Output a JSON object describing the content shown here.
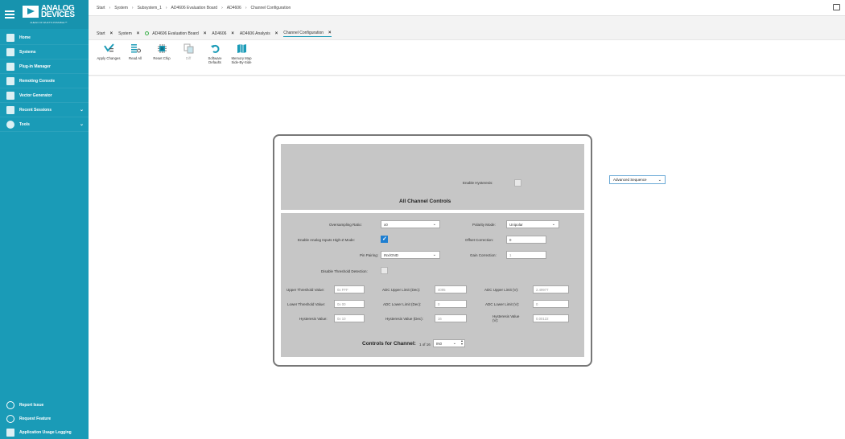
{
  "sidebar": {
    "logo_line1": "ANALOG",
    "logo_line2": "DEVICES",
    "logo_tagline": "AHEAD OF WHAT'S POSSIBLE™",
    "items": [
      {
        "label": "Home",
        "icon": "home-icon"
      },
      {
        "label": "Systems",
        "icon": "systems-icon"
      },
      {
        "label": "Plug-in Manager",
        "icon": "plugin-icon"
      },
      {
        "label": "Remoting Console",
        "icon": "console-icon"
      },
      {
        "label": "Vector Generator",
        "icon": "vector-icon"
      },
      {
        "label": "Recent Sessions",
        "icon": "recent-icon",
        "expandable": true
      },
      {
        "label": "Tools",
        "icon": "tools-icon",
        "expandable": true
      }
    ],
    "bottom_items": [
      {
        "label": "Report Issue",
        "icon": "info-icon"
      },
      {
        "label": "Request Feature",
        "icon": "lightbulb-icon"
      },
      {
        "label": "Application Usage Logging",
        "icon": "log-icon"
      }
    ]
  },
  "breadcrumb": [
    "Start",
    "System",
    "Subsystem_1",
    "AD4606 Evaluation Board",
    "AD4606",
    "Channel Configuration"
  ],
  "tabs": [
    {
      "label": "Start"
    },
    {
      "label": "System"
    },
    {
      "label": "AD4606 Evaluation Board",
      "status": true
    },
    {
      "label": "AD4606"
    },
    {
      "label": "AD4606 Analysis"
    },
    {
      "label": "Channel Configuration",
      "active": true
    }
  ],
  "toolbar": {
    "apply_changes": "Apply Changes",
    "read_all": "Read All",
    "reset_chip": "Reset Chip",
    "diff": "Diff",
    "software_defaults": "Software Defaults",
    "memory_map": "Memory Map Side-By-Side"
  },
  "panel": {
    "enable_hysteresis_label": "Enable Hysteresis:",
    "enable_hysteresis": false,
    "all_channel_title": "All Channel Controls",
    "oversampling_label": "Oversampling Ratio:",
    "oversampling_value": "x0",
    "polarity_label": "Polarity Mode:",
    "polarity_value": "Unipolar",
    "analog_hiz_label": "Enable Analog Inputs High-Z Mode:",
    "analog_hiz": true,
    "offset_label": "Offset Correction:",
    "offset_value": "0",
    "pin_pairing_label": "Pin Pairing:",
    "pin_pairing_value": "INx/GND",
    "gain_label": "Gain Correction:",
    "gain_value": "1",
    "threshold_label": "Disable Threshold Detection:",
    "threshold": false,
    "upper_threshold_label": "Upper Threshold Value:",
    "upper_threshold_value": "0x FFF",
    "adc_upper_label": "ADC Upper Limit (Dec):",
    "adc_upper_value": "4095",
    "adc_upper_v_label": "ADC Upper Limit (V):",
    "adc_upper_v_value": "2.49977",
    "lower_threshold_label": "Lower Threshold Value:",
    "lower_threshold_value": "0x 00",
    "adc_lower_label": "ADC Lower Limit (Dec):",
    "adc_lower_value": "0",
    "adc_lower_v_label": "ADC Lower Limit (V):",
    "adc_lower_v_value": "0",
    "hysteresis_label": "Hysteresis Value:",
    "hysteresis_value": "0x 10",
    "hysteresis_dec_label": "Hysteresis Value (Dec):",
    "hysteresis_dec_value": "16",
    "hysteresis_v_label": "Hysteresis Value (V):",
    "hysteresis_v_value": "0.00122",
    "controls_label": "Controls for Channel:",
    "controls_count": "1 of 16",
    "controls_value": "IN0"
  },
  "advanced_sequence": "Advanced Sequence"
}
